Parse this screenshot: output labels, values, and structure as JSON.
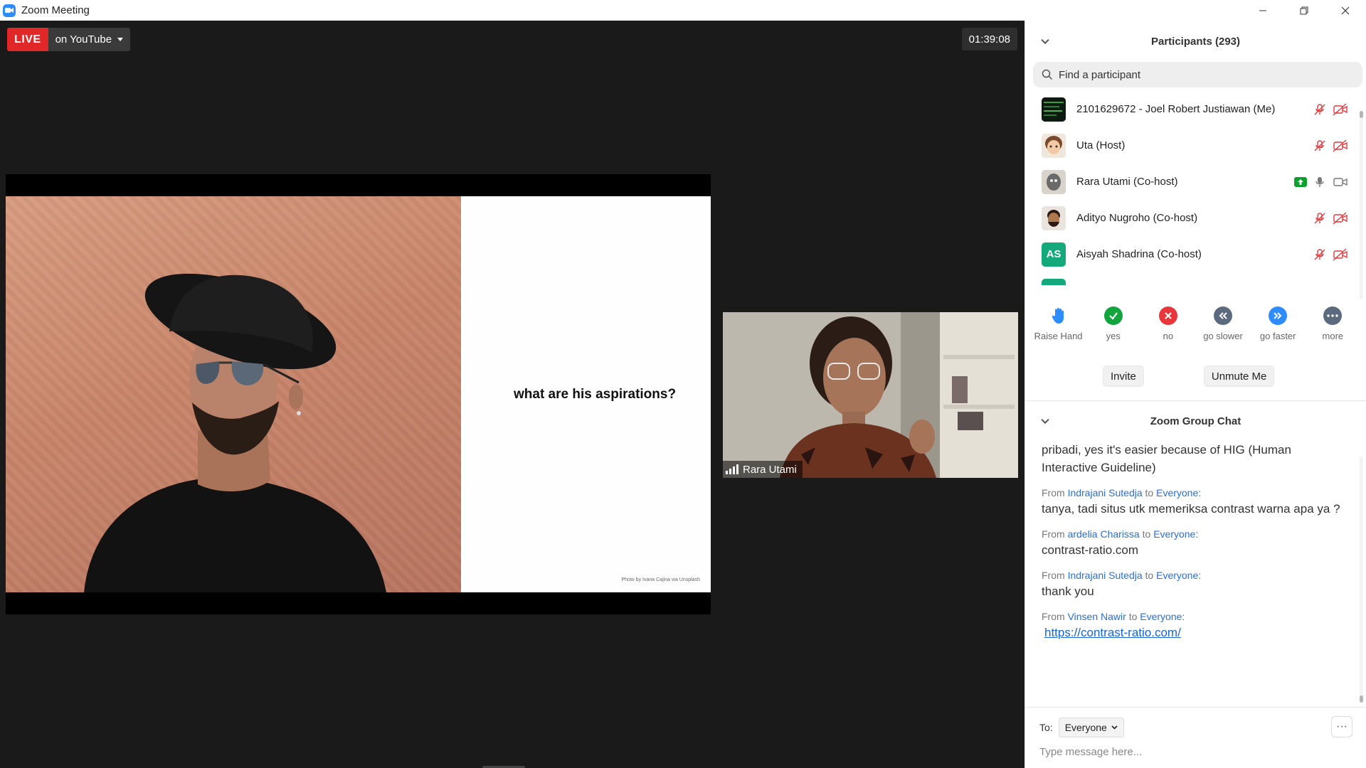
{
  "window": {
    "title": "Zoom Meeting",
    "controls": [
      "minimize",
      "restore",
      "close"
    ]
  },
  "stream": {
    "live_label": "LIVE",
    "target": "on YouTube",
    "timer": "01:39:08"
  },
  "slide": {
    "question": "what are his aspirations?",
    "credit": "Photo by Ivana Cajina via Unsplash"
  },
  "video": {
    "speaker_name": "Rara Utami"
  },
  "participants": {
    "title": "Participants (293)",
    "search_placeholder": "Find a participant",
    "list": [
      {
        "name": "2101629672 - Joel Robert Justiawan (Me)",
        "avatar": "image",
        "audio": "muted",
        "video": "off"
      },
      {
        "name": "Uta (Host)",
        "avatar": "image",
        "audio": "muted",
        "video": "off"
      },
      {
        "name": "Rara Utami (Co-host)",
        "avatar": "image",
        "audio": "on",
        "video": "on",
        "sharing": true
      },
      {
        "name": "Adityo Nugroho (Co-host)",
        "avatar": "image",
        "audio": "muted",
        "video": "off"
      },
      {
        "name": "Aisyah Shadrina (Co-host)",
        "avatar": "AS",
        "audio": "muted",
        "video": "off"
      }
    ],
    "reactions": [
      {
        "label": "Raise Hand",
        "icon": "raise-hand-icon",
        "color": "#2d8cff"
      },
      {
        "label": "yes",
        "icon": "check-icon",
        "color": "#12a53e"
      },
      {
        "label": "no",
        "icon": "x-icon",
        "color": "#e8363a"
      },
      {
        "label": "go slower",
        "icon": "rewind-icon",
        "color": "#5c6a7e"
      },
      {
        "label": "go faster",
        "icon": "fast-forward-icon",
        "color": "#2d8cff"
      },
      {
        "label": "more",
        "icon": "more-icon",
        "color": "#5c6a7e"
      }
    ],
    "invite_label": "Invite",
    "unmute_label": "Unmute Me"
  },
  "chat": {
    "title": "Zoom Group Chat",
    "continued_text": "pribadi, yes it's easier because of HIG (Human Interactive Guideline)",
    "messages": [
      {
        "from_prefix": "From",
        "sender": "Indrajani Sutedja",
        "to_word": "to",
        "recipient": "Everyone:",
        "text": "tanya, tadi situs utk memeriksa contrast warna apa ya ?"
      },
      {
        "from_prefix": "From",
        "sender": "ardelia Charissa",
        "to_word": "to",
        "recipient": "Everyone:",
        "text": "contrast-ratio.com"
      },
      {
        "from_prefix": "From",
        "sender": "Indrajani Sutedja",
        "to_word": "to",
        "recipient": "Everyone:",
        "text": "thank you"
      },
      {
        "from_prefix": "From",
        "sender": "Vinsen Nawir",
        "to_word": "to",
        "recipient": "Everyone:",
        "link": "https://contrast-ratio.com/"
      }
    ],
    "to_label": "To:",
    "to_value": "Everyone",
    "more_label": "···",
    "input_placeholder": "Type message here..."
  },
  "colors": {
    "live": "#e02828",
    "accent": "#2d8cff",
    "muted_icon": "#e0393e",
    "sharing": "#0e9f2e"
  }
}
